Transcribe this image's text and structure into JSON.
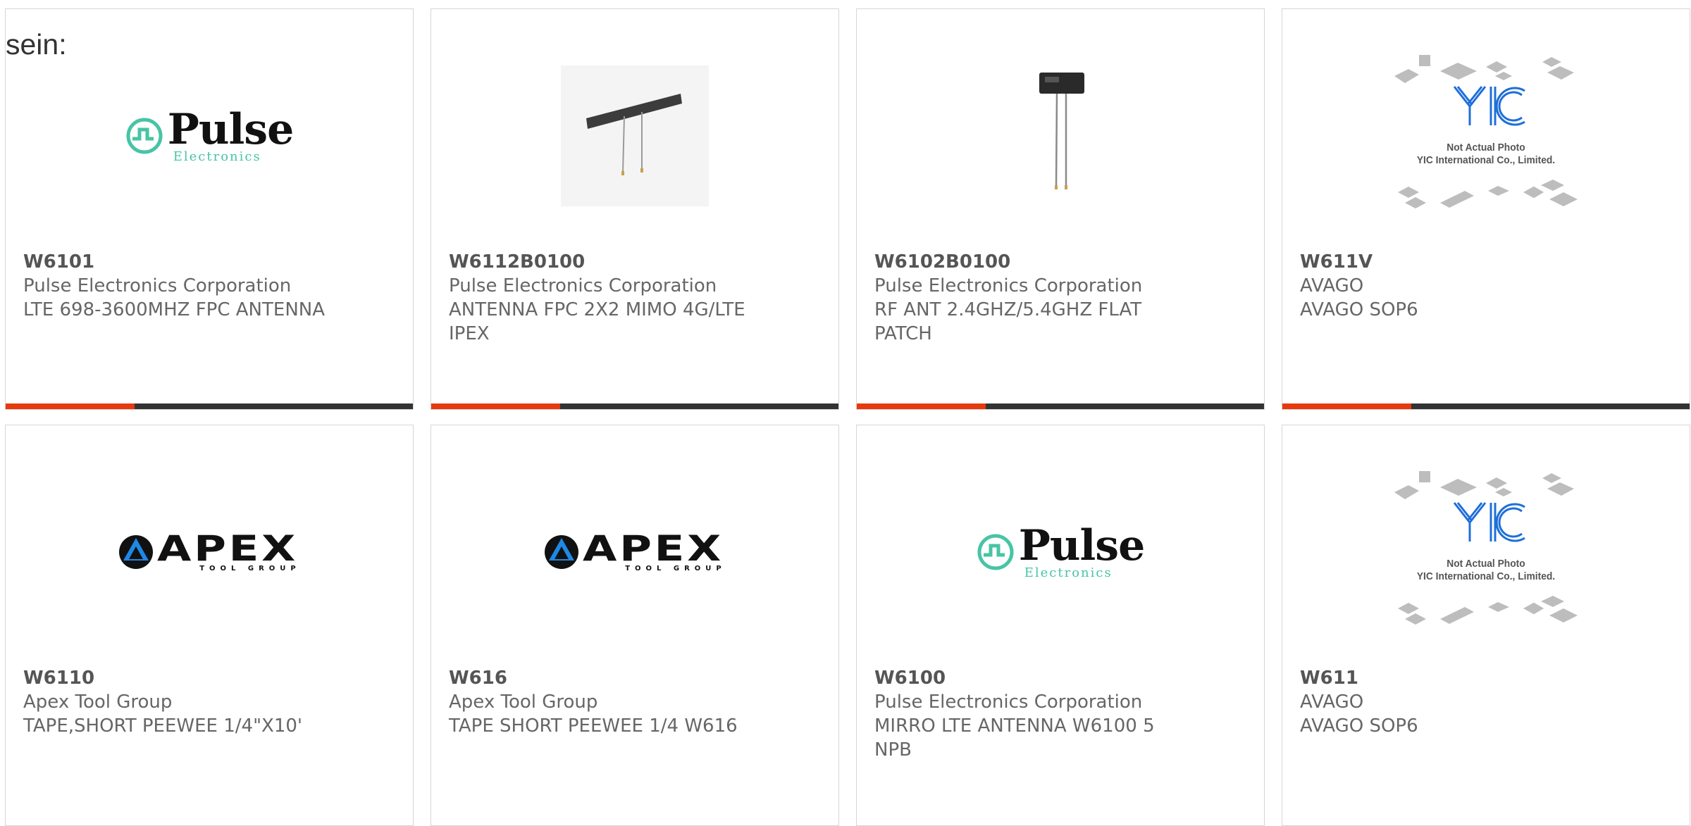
{
  "stray_text": "sein:",
  "colors": {
    "accent_orange": "#e8380d",
    "accent_dark": "#333333",
    "card_border": "#d6d6d6",
    "text": "#666666",
    "pulse_teal": "#48c4a4"
  },
  "products": [
    {
      "part_number": "W6101",
      "manufacturer": "Pulse Electronics Corporation",
      "description": "LTE 698-3600MHZ FPC ANTENNA",
      "image": {
        "type": "logo",
        "brand": "Pulse",
        "sub": "Electronics"
      }
    },
    {
      "part_number": "W6112B0100",
      "manufacturer": "Pulse Electronics Corporation",
      "description": "ANTENNA FPC 2X2 MIMO 4G/LTE IPEX",
      "image": {
        "type": "photo",
        "subject": "flat-antenna-photo"
      }
    },
    {
      "part_number": "W6102B0100",
      "manufacturer": "Pulse Electronics Corporation",
      "description": "RF ANT 2.4GHZ/5.4GHZ FLAT PATCH",
      "image": {
        "type": "photo",
        "subject": "patch-antenna-photo"
      }
    },
    {
      "part_number": "W611V",
      "manufacturer": "AVAGO",
      "description": "AVAGO SOP6",
      "image": {
        "type": "placeholder",
        "line1": "Not Actual Photo",
        "line2": "YIC International Co., Limited."
      }
    },
    {
      "part_number": "W6110",
      "manufacturer": "Apex Tool Group",
      "description": "TAPE,SHORT PEEWEE 1/4\"X10'",
      "image": {
        "type": "logo",
        "brand": "APEX",
        "sub": "TOOL GROUP"
      }
    },
    {
      "part_number": "W616",
      "manufacturer": "Apex Tool Group",
      "description": "TAPE SHORT PEEWEE 1/4 W616",
      "image": {
        "type": "logo",
        "brand": "APEX",
        "sub": "TOOL GROUP"
      }
    },
    {
      "part_number": "W6100",
      "manufacturer": "Pulse Electronics Corporation",
      "description": "MIRRO LTE ANTENNA W6100 5 NPB",
      "image": {
        "type": "logo",
        "brand": "Pulse",
        "sub": "Electronics"
      }
    },
    {
      "part_number": "W611",
      "manufacturer": "AVAGO",
      "description": "AVAGO SOP6",
      "image": {
        "type": "placeholder",
        "line1": "Not Actual Photo",
        "line2": "YIC International Co., Limited."
      }
    }
  ]
}
